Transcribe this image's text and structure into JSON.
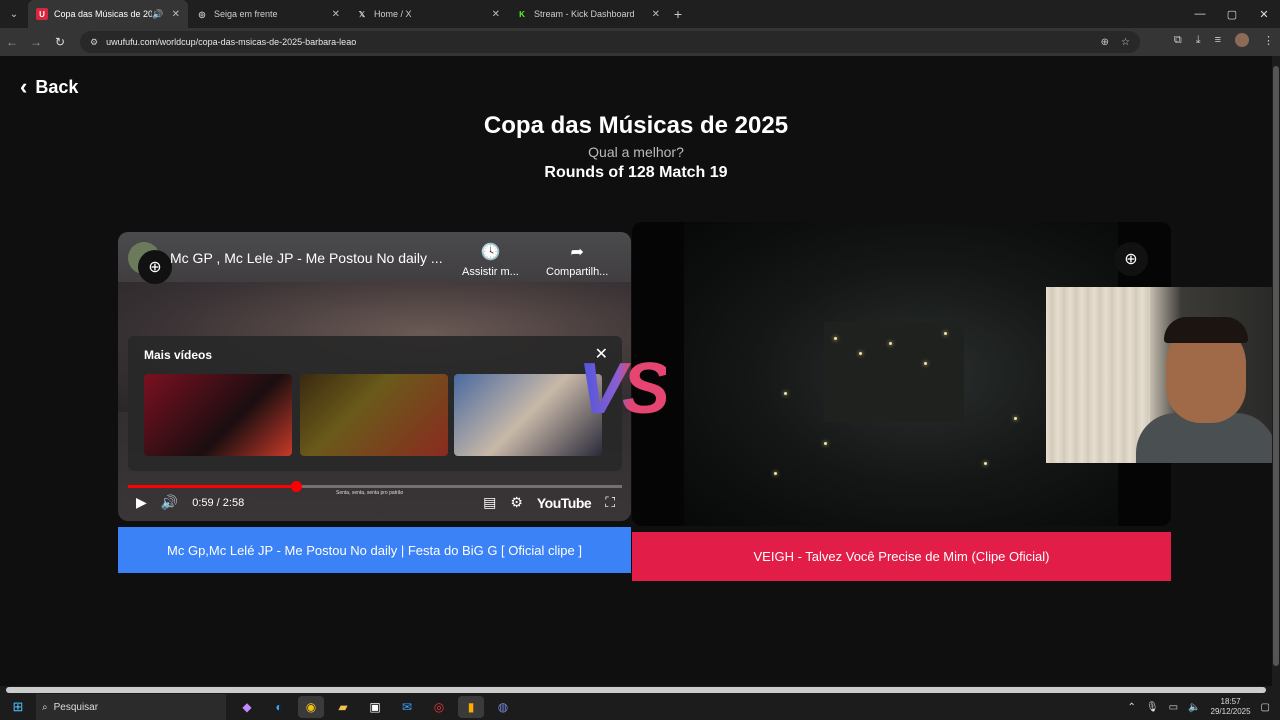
{
  "browser": {
    "tabs": [
      {
        "title": "Copa das Músicas de 2025",
        "favicon": "U",
        "favicon_color": "#d7263d",
        "active": true,
        "audio": true
      },
      {
        "title": "Seiga em frente",
        "favicon": "◎",
        "favicon_color": "#ffffff",
        "active": false
      },
      {
        "title": "Home / X",
        "favicon": "𝕏",
        "favicon_color": "#ffffff",
        "active": false
      },
      {
        "title": "Stream - Kick Dashboard",
        "favicon": "K",
        "favicon_color": "#53fc18",
        "active": false
      }
    ],
    "url": "uwufufu.com/worldcup/copa-das-msicas-de-2025-barbara-leao"
  },
  "page": {
    "back_label": "Back",
    "title": "Copa das Músicas de 2025",
    "subtitle": "Qual a melhor?",
    "round": "Rounds of 128 Match 19",
    "vs_label": "VS"
  },
  "left_video": {
    "title": "Mc GP , Mc Lele JP - Me Postou No daily ...",
    "watch_later": "Assistir m...",
    "share": "Compartilh...",
    "more_videos": "Mais vídeos",
    "time": "0:59 / 2:58",
    "caption": "Senta, senta, senta pro patrão",
    "youtube_logo": "YouTube",
    "progress": 0.34
  },
  "choices": {
    "left": "Mc Gp,Mc Lelé JP - Me Postou No daily | Festa do BiG G [ Oficial clipe ]",
    "right": "VEIGH - Talvez Você Precise de Mim (Clipe Oficial)"
  },
  "taskbar": {
    "search_placeholder": "Pesquisar",
    "time": "18:57",
    "date": "29/12/2025"
  },
  "colors": {
    "left_button": "#3b82f6",
    "right_button": "#e11d48"
  }
}
